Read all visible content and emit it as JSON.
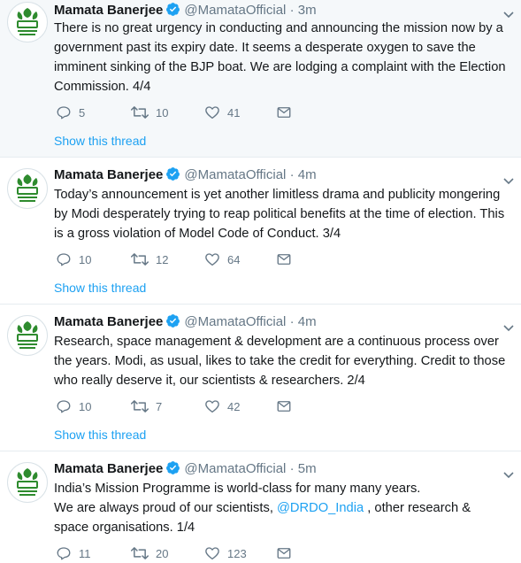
{
  "colors": {
    "link": "#1da1f2",
    "muted": "#657786",
    "verified": "#1da1f2",
    "highlight_bg": "#f5f8fa",
    "avatar_green": "#2e8b2e"
  },
  "tweets": [
    {
      "name": "Mamata Banerjee",
      "handle": "@MamataOfficial",
      "time": "· 3m",
      "text": "There is no great urgency in conducting and announcing the mission now by a government past its expiry date. It seems a desperate oxygen to save the imminent sinking of the BJP boat. We are lodging a complaint with the Election Commission. 4/4",
      "replies": "5",
      "retweets": "10",
      "likes": "41",
      "show_thread": "Show this thread"
    },
    {
      "name": "Mamata Banerjee",
      "handle": "@MamataOfficial",
      "time": "· 4m",
      "text": "Today’s announcement is yet another limitless drama and publicity mongering by Modi desperately trying to reap political benefits at the time of election. This is a gross violation of Model Code of Conduct. 3/4",
      "replies": "10",
      "retweets": "12",
      "likes": "64",
      "show_thread": "Show this thread"
    },
    {
      "name": "Mamata Banerjee",
      "handle": "@MamataOfficial",
      "time": "· 4m",
      "text": "Research, space management & development are a continuous process over the years. Modi, as usual, likes to take the credit for everything. Credit to those who really deserve it, our scientists & researchers. 2/4",
      "replies": "10",
      "retweets": "7",
      "likes": "42",
      "show_thread": "Show this thread"
    },
    {
      "name": "Mamata Banerjee",
      "handle": "@MamataOfficial",
      "time": "· 5m",
      "text_line1": "India’s Mission Programme is world-class for many many years.",
      "text_line2_before": "We are always proud of our scientists, ",
      "mention": "@DRDO_India",
      "text_line2_after": " , other research & space organisations. 1/4",
      "replies": "11",
      "retweets": "20",
      "likes": "123"
    }
  ],
  "icons": {
    "avatar": "trinamool-party-logo-avatar",
    "verified": "verified-badge-icon",
    "caret": "chevron-down-icon",
    "reply": "reply-icon",
    "retweet": "retweet-icon",
    "like": "heart-icon",
    "dm": "envelope-icon"
  }
}
